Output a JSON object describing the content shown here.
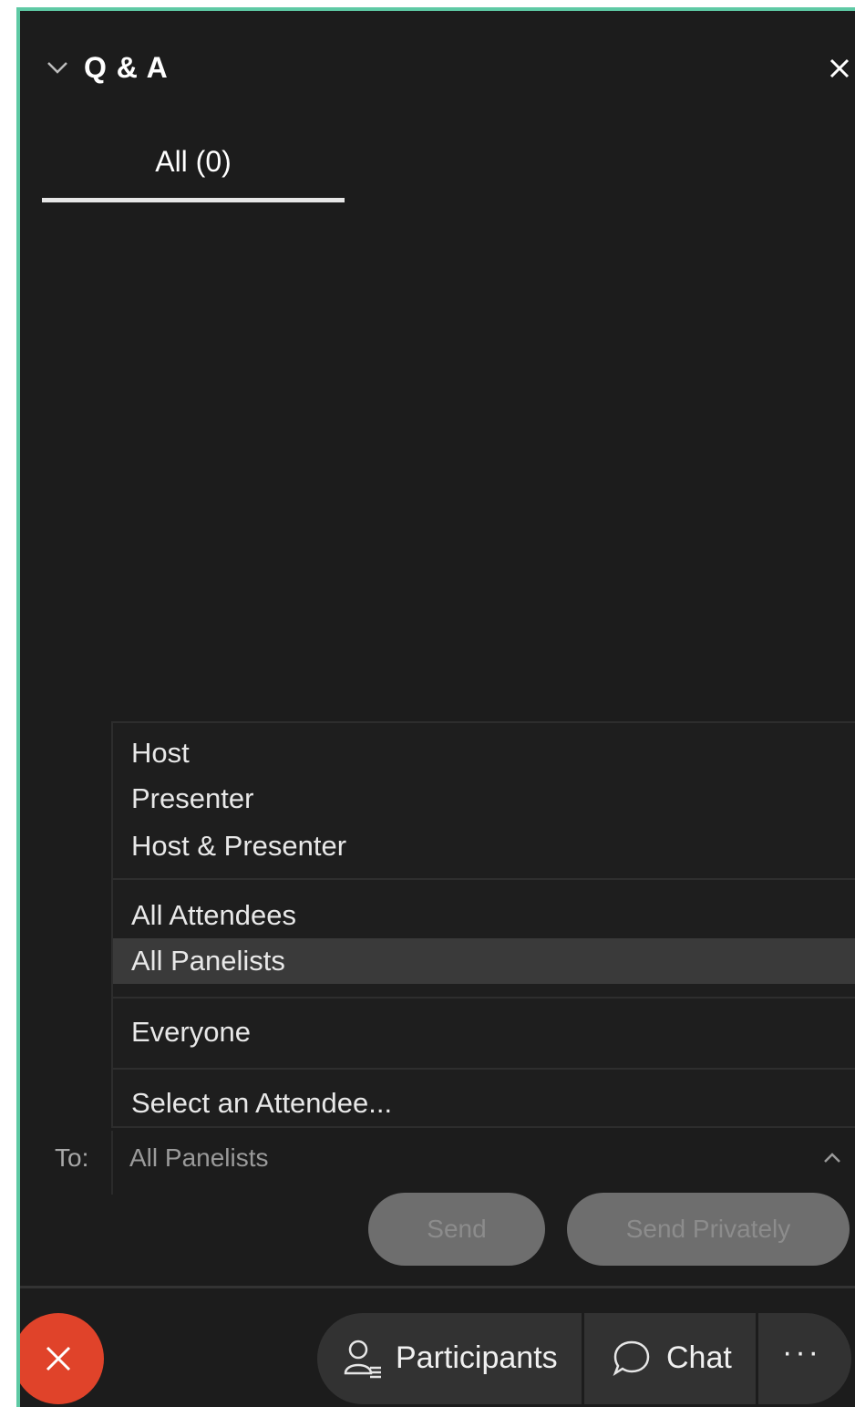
{
  "panel": {
    "title": "Q & A"
  },
  "tabs": [
    {
      "label": "All (0)"
    }
  ],
  "dropdown": {
    "items": [
      {
        "label": "Host"
      },
      {
        "label": "Presenter"
      },
      {
        "label": "Host & Presenter"
      },
      {
        "label": "All Attendees"
      },
      {
        "label": "All Panelists"
      },
      {
        "label": "Everyone"
      },
      {
        "label": "Select an Attendee..."
      }
    ],
    "selected": "All Panelists"
  },
  "to_row": {
    "label": "To:",
    "value": "All Panelists"
  },
  "buttons": {
    "send": "Send",
    "send_privately": "Send Privately"
  },
  "control_bar": {
    "participants": "Participants",
    "chat": "Chat",
    "more": "···"
  },
  "colors": {
    "background": "#1c1c1c",
    "frame_border": "#5ec9a4",
    "leave_button": "#e0432a",
    "selected_item": "#3a3a3a",
    "disabled_button": "#6e6e6e"
  },
  "icons": {
    "collapse": "chevron-down-icon",
    "close": "close-icon",
    "dropdown_toggle": "chevron-up-icon",
    "leave": "close-icon",
    "participants": "person-list-icon",
    "chat": "chat-bubble-icon",
    "more": "more-icon"
  }
}
